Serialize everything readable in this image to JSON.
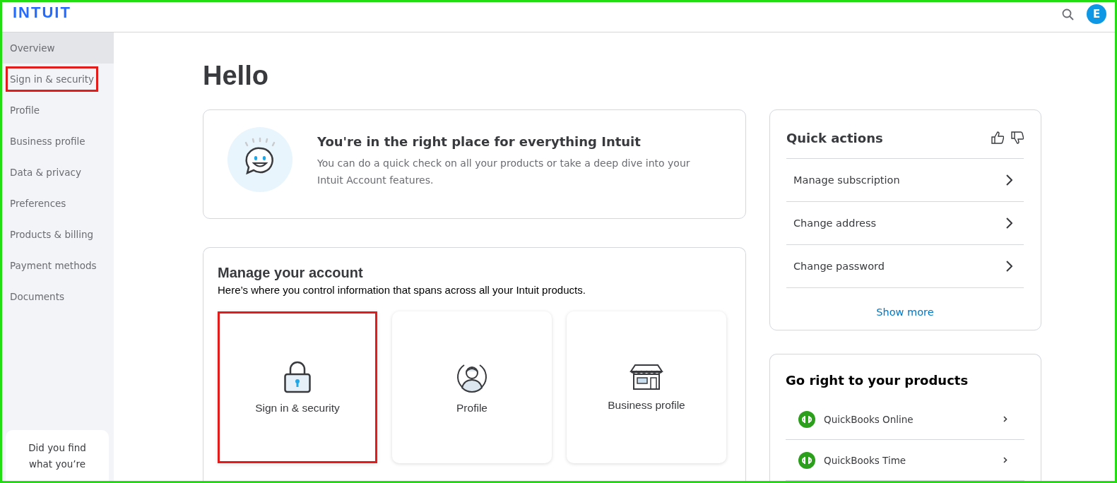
{
  "header": {
    "logo": "INTUIT",
    "avatar_initial": "E"
  },
  "sidebar": {
    "items": [
      {
        "label": "Overview",
        "selected": true,
        "highlighted": false
      },
      {
        "label": "Sign in & security",
        "selected": false,
        "highlighted": true
      },
      {
        "label": "Profile",
        "selected": false,
        "highlighted": false
      },
      {
        "label": "Business profile",
        "selected": false,
        "highlighted": false
      },
      {
        "label": "Data & privacy",
        "selected": false,
        "highlighted": false
      },
      {
        "label": "Preferences",
        "selected": false,
        "highlighted": false
      },
      {
        "label": "Products & billing",
        "selected": false,
        "highlighted": false
      },
      {
        "label": "Payment methods",
        "selected": false,
        "highlighted": false
      },
      {
        "label": "Documents",
        "selected": false,
        "highlighted": false
      }
    ],
    "feedback": "Did you find what you’re"
  },
  "greeting": "Hello",
  "banner": {
    "title": "You're in the right place for everything Intuit",
    "text": "You can do a quick check on all your products or take a deep dive into your Intuit Account features."
  },
  "manage": {
    "title": "Manage your account",
    "subtitle": "Here’s where you control information that spans across all your Intuit products.",
    "tiles": [
      {
        "kind": "lock",
        "label": "Sign in & security",
        "highlighted": true
      },
      {
        "kind": "person",
        "label": "Profile",
        "highlighted": false
      },
      {
        "kind": "store",
        "label": "Business profile",
        "highlighted": false
      }
    ]
  },
  "quick_actions": {
    "title": "Quick actions",
    "items": [
      "Manage subscription",
      "Change address",
      "Change password"
    ],
    "show_more": "Show more"
  },
  "products": {
    "title": "Go right to your products",
    "items": [
      "QuickBooks Online",
      "QuickBooks Time"
    ]
  }
}
